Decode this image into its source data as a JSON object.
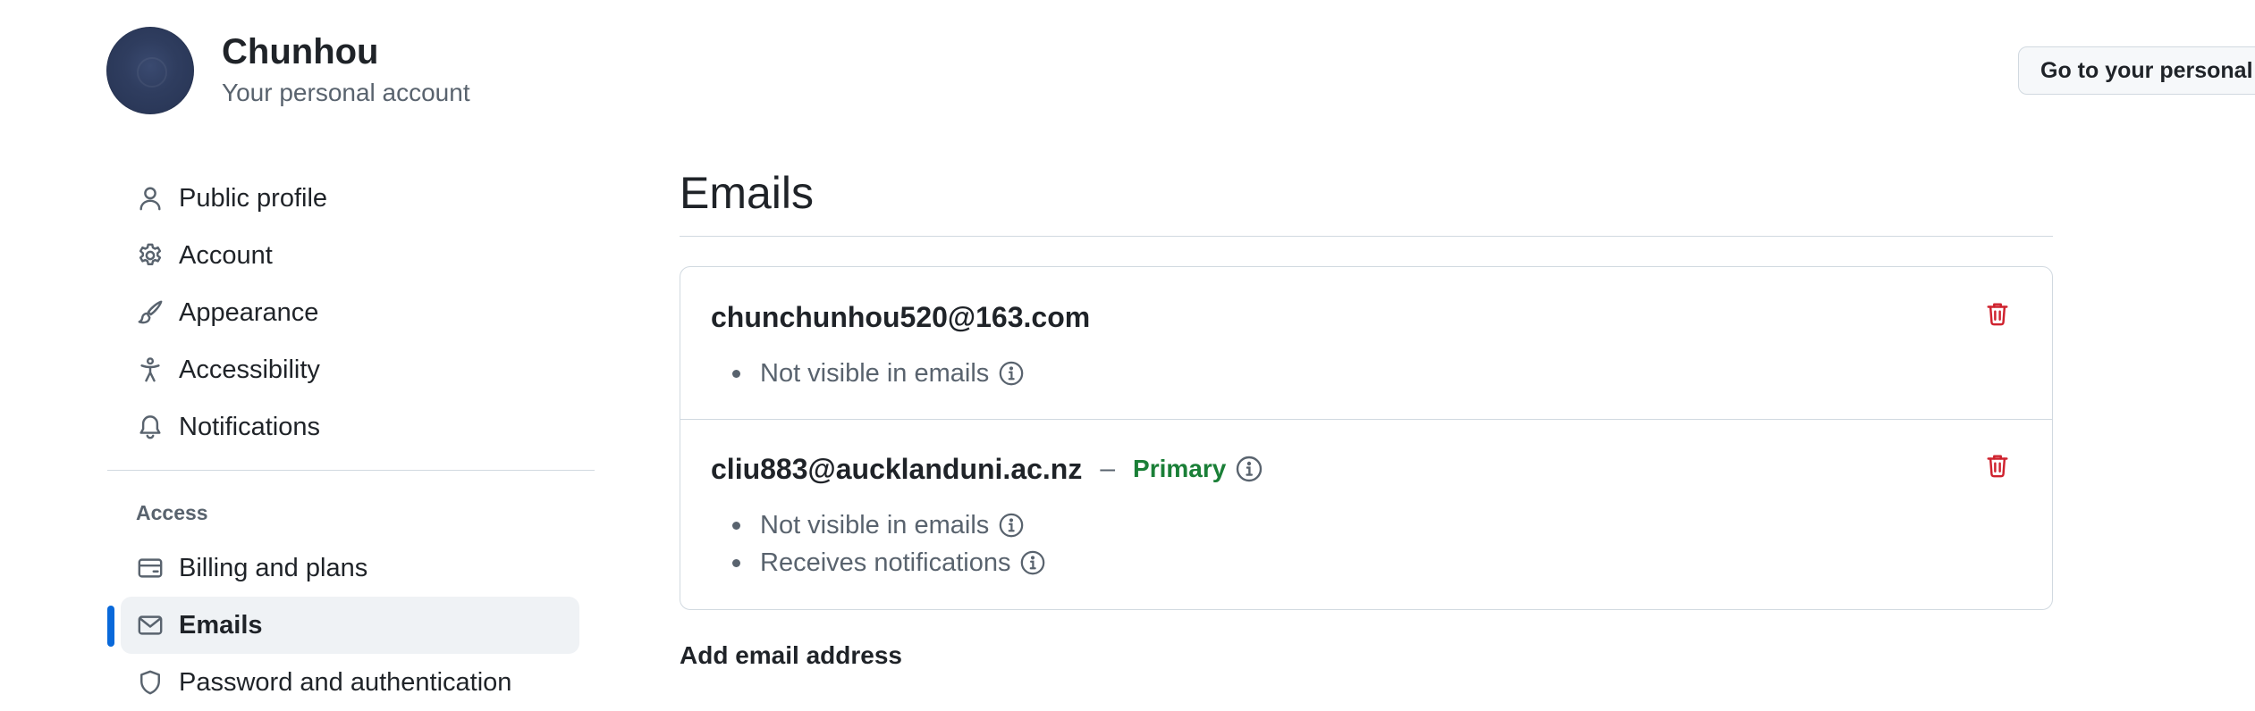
{
  "header": {
    "user_name": "Chunhou",
    "account_subtitle": "Your personal account",
    "goto_profile_label": "Go to your personal profile"
  },
  "sidebar": {
    "items": [
      {
        "label": "Public profile",
        "icon": "person-icon"
      },
      {
        "label": "Account",
        "icon": "gear-icon"
      },
      {
        "label": "Appearance",
        "icon": "paintbrush-icon"
      },
      {
        "label": "Accessibility",
        "icon": "accessibility-icon"
      },
      {
        "label": "Notifications",
        "icon": "bell-icon"
      }
    ],
    "access_heading": "Access",
    "access_items": [
      {
        "label": "Billing and plans",
        "icon": "credit-card-icon"
      },
      {
        "label": "Emails",
        "icon": "mail-icon",
        "selected": true
      },
      {
        "label": "Password and authentication",
        "icon": "shield-lock-icon"
      }
    ]
  },
  "main": {
    "title": "Emails",
    "emails": [
      {
        "address": "chunchunhou520@163.com",
        "properties": [
          "Not visible in emails"
        ]
      },
      {
        "address": "cliu883@aucklanduni.ac.nz",
        "separator": "–",
        "badge": "Primary",
        "properties": [
          "Not visible in emails",
          "Receives notifications"
        ]
      }
    ],
    "add_email_heading": "Add email address"
  },
  "colors": {
    "accent": "#0969da",
    "primary_badge": "#1a7f37",
    "danger": "#cf222e",
    "muted_text": "#59636e",
    "border": "#d1d9e0",
    "selected_bg": "#eff2f5"
  }
}
